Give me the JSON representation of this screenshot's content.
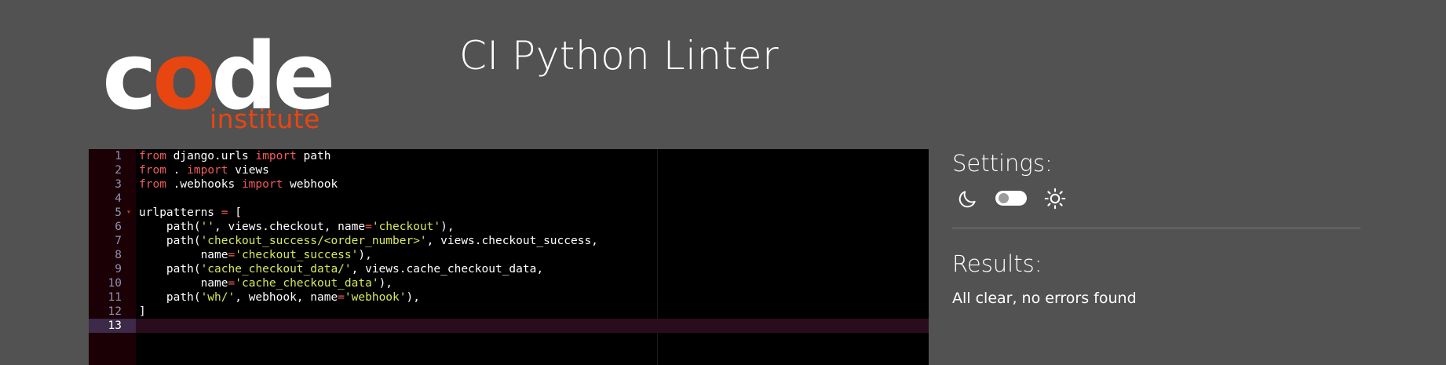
{
  "logo": {
    "code_prefix": "c",
    "code_accent": "o",
    "code_suffix": "de",
    "subtitle": "institute",
    "accent_color": "#e84610"
  },
  "header": {
    "title": "CI Python Linter"
  },
  "editor": {
    "active_line": 13,
    "lines": [
      {
        "n": "1",
        "tokens": [
          {
            "t": "from",
            "c": "kw"
          },
          {
            "t": " django.urls ",
            "c": ""
          },
          {
            "t": "import",
            "c": "kw"
          },
          {
            "t": " path",
            "c": ""
          }
        ]
      },
      {
        "n": "2",
        "tokens": [
          {
            "t": "from",
            "c": "kw"
          },
          {
            "t": " . ",
            "c": ""
          },
          {
            "t": "import",
            "c": "kw"
          },
          {
            "t": " views",
            "c": ""
          }
        ]
      },
      {
        "n": "3",
        "tokens": [
          {
            "t": "from",
            "c": "kw"
          },
          {
            "t": " .webhooks ",
            "c": ""
          },
          {
            "t": "import",
            "c": "kw"
          },
          {
            "t": " webhook",
            "c": ""
          }
        ]
      },
      {
        "n": "4",
        "tokens": []
      },
      {
        "n": "5",
        "fold": true,
        "tokens": [
          {
            "t": "urlpatterns ",
            "c": ""
          },
          {
            "t": "=",
            "c": "op"
          },
          {
            "t": " [",
            "c": ""
          }
        ]
      },
      {
        "n": "6",
        "tokens": [
          {
            "t": "    path(",
            "c": ""
          },
          {
            "t": "''",
            "c": "str"
          },
          {
            "t": ", views.checkout, name",
            "c": ""
          },
          {
            "t": "=",
            "c": "op"
          },
          {
            "t": "'checkout'",
            "c": "str"
          },
          {
            "t": "),",
            "c": ""
          }
        ]
      },
      {
        "n": "7",
        "tokens": [
          {
            "t": "    path(",
            "c": ""
          },
          {
            "t": "'checkout_success/<order_number>'",
            "c": "str"
          },
          {
            "t": ", views.checkout_success,",
            "c": ""
          }
        ]
      },
      {
        "n": "8",
        "tokens": [
          {
            "t": "         name",
            "c": ""
          },
          {
            "t": "=",
            "c": "op"
          },
          {
            "t": "'checkout_success'",
            "c": "str"
          },
          {
            "t": "),",
            "c": ""
          }
        ]
      },
      {
        "n": "9",
        "tokens": [
          {
            "t": "    path(",
            "c": ""
          },
          {
            "t": "'cache_checkout_data/'",
            "c": "str"
          },
          {
            "t": ", views.cache_checkout_data,",
            "c": ""
          }
        ]
      },
      {
        "n": "10",
        "tokens": [
          {
            "t": "         name",
            "c": ""
          },
          {
            "t": "=",
            "c": "op"
          },
          {
            "t": "'cache_checkout_data'",
            "c": "str"
          },
          {
            "t": "),",
            "c": ""
          }
        ]
      },
      {
        "n": "11",
        "tokens": [
          {
            "t": "    path(",
            "c": ""
          },
          {
            "t": "'wh/'",
            "c": "str"
          },
          {
            "t": ", webhook, name",
            "c": ""
          },
          {
            "t": "=",
            "c": "op"
          },
          {
            "t": "'webhook'",
            "c": "str"
          },
          {
            "t": "),",
            "c": ""
          }
        ]
      },
      {
        "n": "12",
        "tokens": [
          {
            "t": "]",
            "c": ""
          }
        ]
      },
      {
        "n": "13",
        "tokens": []
      }
    ]
  },
  "settings": {
    "title": "Settings:",
    "dark_icon": "moon-icon",
    "light_icon": "sun-icon",
    "theme_toggle_on": false
  },
  "results": {
    "title": "Results:",
    "message": "All clear, no errors found"
  }
}
